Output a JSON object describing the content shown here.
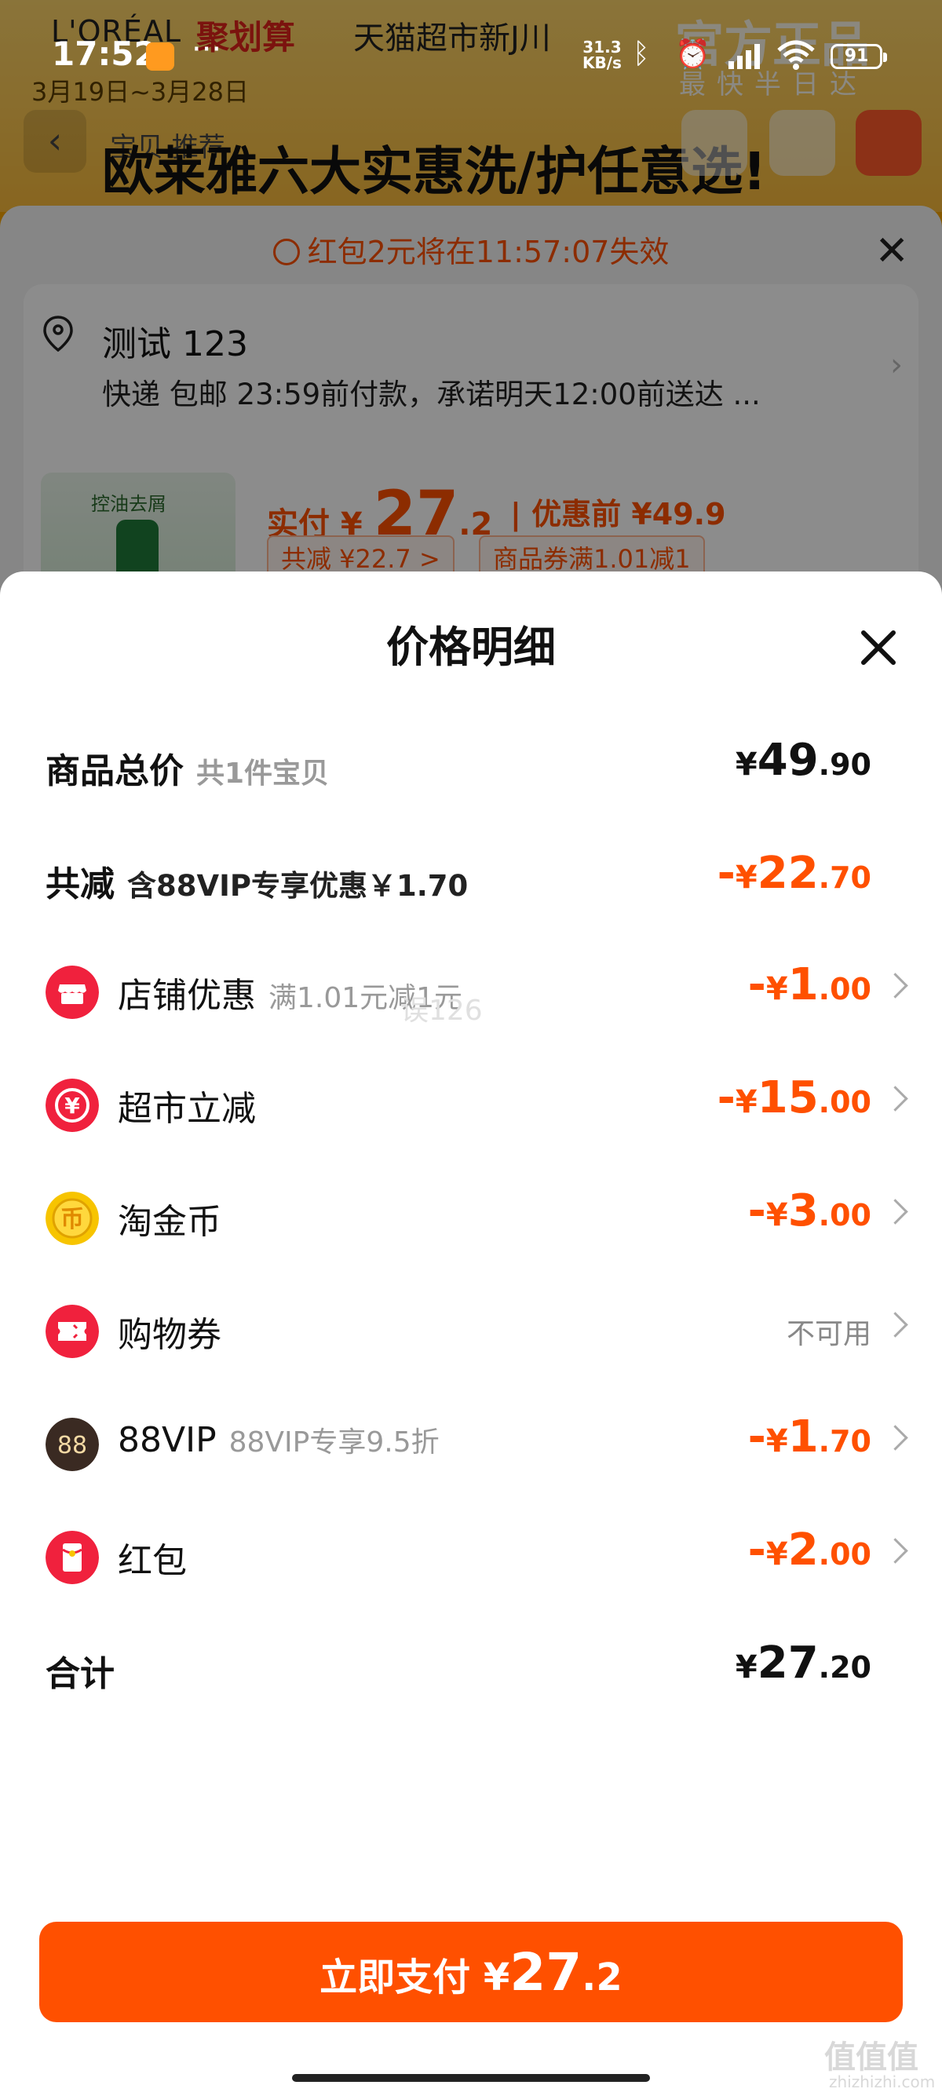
{
  "status_bar": {
    "time": "17:52",
    "dots": "···",
    "net_speed_top": "31.3",
    "net_speed_bottom": "KB/s",
    "battery": "91"
  },
  "background": {
    "brand": "L'ORÉAL",
    "juhuasuan": "聚划算",
    "tmall": "天猫超市新J川",
    "official": "官方正品",
    "fast": "最快半日达",
    "date": "3月19日~3月28日",
    "headline": "欧莱雅六大实惠洗/护任意选!",
    "tab_text": "宝贝 推荐",
    "notice": "红包2元将在11:57:07失效",
    "address_name": "测试 123",
    "delivery": "快递 包邮 23:59前付款，承诺明天12:00前送达 ...",
    "product_label": "控油去屑",
    "paid_label": "实付 ¥",
    "paid_int": "27",
    "paid_dec": ".2",
    "before": "| 优惠前 ¥49.9",
    "tag_total_off": "共减 ¥22.7 >",
    "tag_coupon": "商品券满1.01减1"
  },
  "sheet": {
    "title": "价格明细",
    "rows": [
      {
        "label": "商品总价",
        "sub": "共1件宝贝",
        "prefix": "",
        "cur": "¥",
        "int": "49",
        "dec": ".90"
      },
      {
        "label": "共减",
        "sub": "含88VIP专享优惠￥1.70",
        "prefix": "-",
        "cur": "¥",
        "int": "22",
        "dec": ".70"
      },
      {
        "label": "店铺优惠",
        "sub": "满1.01元减1元",
        "prefix": "-",
        "cur": "¥",
        "int": "1",
        "dec": ".00"
      },
      {
        "label": "超市立减",
        "sub": "",
        "prefix": "-",
        "cur": "¥",
        "int": "15",
        "dec": ".00"
      },
      {
        "label": "淘金币",
        "sub": "",
        "prefix": "-",
        "cur": "¥",
        "int": "3",
        "dec": ".00"
      },
      {
        "label": "购物券",
        "sub": "",
        "status": "不可用"
      },
      {
        "label": "88VIP",
        "sub": "88VIP专享9.5折",
        "prefix": "-",
        "cur": "¥",
        "int": "1",
        "dec": ".70"
      },
      {
        "label": "红包",
        "sub": "",
        "prefix": "-",
        "cur": "¥",
        "int": "2",
        "dec": ".00"
      },
      {
        "label": "合计",
        "sub": "",
        "prefix": "",
        "cur": "¥",
        "int": "27",
        "dec": ".20"
      }
    ],
    "overlay_text": "误126",
    "pay_button": {
      "label": "立即支付",
      "cur": "¥",
      "int": "27",
      "dec": ".2"
    }
  },
  "watermark": {
    "main": "值值值",
    "domain": "zhizhizhi.com"
  },
  "colors": {
    "accent": "#ff5000",
    "shop_icon": "#f0213d",
    "coin_icon": "#f7c400",
    "vip_icon": "#3a2a22"
  }
}
